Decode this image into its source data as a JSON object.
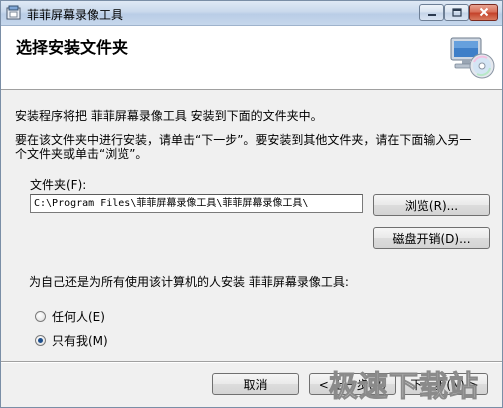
{
  "window": {
    "title": "菲菲屏幕录像工具"
  },
  "header": {
    "title": "选择安装文件夹",
    "icon": "computer-cd-icon"
  },
  "body": {
    "line1": "安装程序将把 菲菲屏幕录像工具 安装到下面的文件夹中。",
    "line2a": "要在该文件夹中进行安装，请单击“下一步”。要安装到其他文件夹，请在下面输入另一",
    "line2b": "个文件夹或单击“浏览”。",
    "folder_label": "文件夹(F):",
    "folder_value": "C:\\Program Files\\菲菲屏幕录像工具\\菲菲屏幕录像工具\\",
    "browse_label": "浏览(R)...",
    "disk_cost_label": "磁盘开销(D)...",
    "users_question": "为自己还是为所有使用该计算机的人安装 菲菲屏幕录像工具:",
    "options": [
      {
        "label": "任何人(E)",
        "checked": false
      },
      {
        "label": "只有我(M)",
        "checked": true
      }
    ]
  },
  "footer": {
    "cancel_label": "取消",
    "back_label": "< 上一步(B)",
    "next_label": "下一步(N) >"
  },
  "watermark": "极速下载站",
  "colors": {
    "titlebar": "#c9d9ec",
    "close_button": "#c4432b",
    "dialog_bg": "#f0f0f0",
    "header_bg": "#ffffff"
  }
}
